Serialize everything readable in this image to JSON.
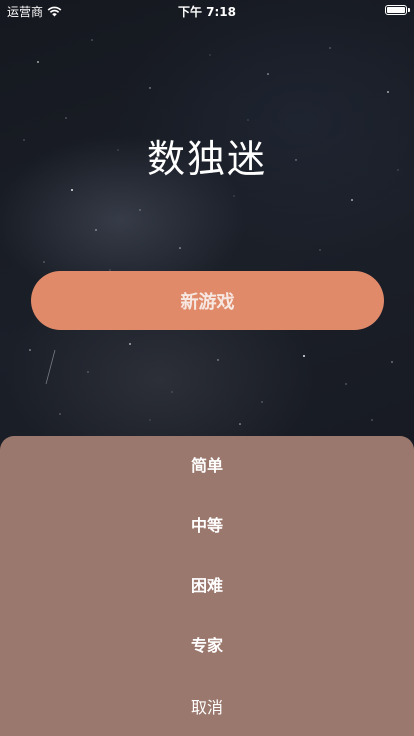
{
  "status_bar": {
    "carrier": "运营商",
    "time": "下午 7:18"
  },
  "main": {
    "title": "数独迷",
    "new_game_label": "新游戏"
  },
  "action_sheet": {
    "options": [
      "简单",
      "中等",
      "困难",
      "专家"
    ],
    "cancel_label": "取消"
  },
  "colors": {
    "button": "#e08a6a",
    "sheet": "#9b786d"
  }
}
